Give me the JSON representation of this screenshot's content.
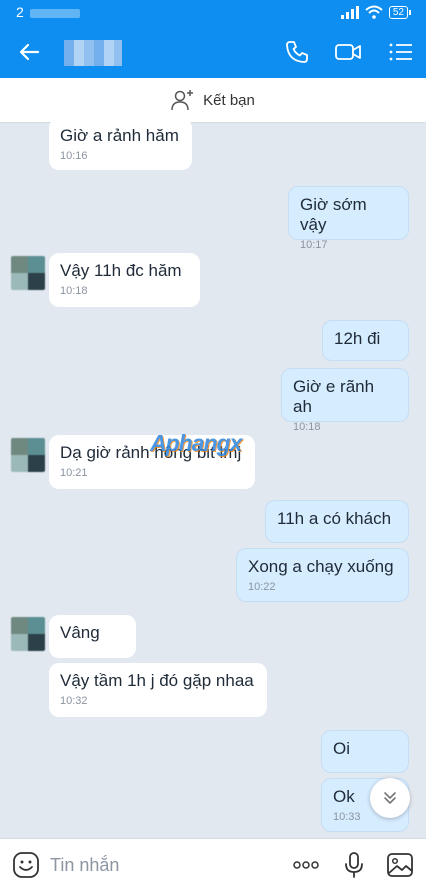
{
  "status_bar": {
    "time": "2",
    "battery": "52"
  },
  "header": {
    "back_label": "back"
  },
  "add_friend": {
    "label": "Kết bạn"
  },
  "messages": [
    {
      "dir": "in",
      "text": "Giờ a rảnh hăm",
      "time": "10:16"
    },
    {
      "dir": "out",
      "text": "Giờ sớm vậy",
      "time": "10:17"
    },
    {
      "dir": "in",
      "text": "Vậy 11h đc hăm",
      "time": "10:18"
    },
    {
      "dir": "out",
      "text": "12h đi",
      "time": ""
    },
    {
      "dir": "out",
      "text": "Giờ e rãnh ah",
      "time": "10:18"
    },
    {
      "dir": "in",
      "text": "Dạ giờ rảnh hông bit lmj",
      "time": "10:21"
    },
    {
      "dir": "out",
      "text": "11h a có khách",
      "time": ""
    },
    {
      "dir": "out",
      "text": "Xong a chạy xuống",
      "time": "10:22"
    },
    {
      "dir": "in",
      "text": "Vâng",
      "time": ""
    },
    {
      "dir": "in",
      "text": "Vậy tầm 1h j đó gặp nhaa",
      "time": "10:32"
    },
    {
      "dir": "out",
      "text": "Oi",
      "time": ""
    },
    {
      "dir": "out",
      "text": "Ok",
      "time": "10:33"
    }
  ],
  "watermark": "Aphangx",
  "composer": {
    "placeholder": "Tin nhắn"
  },
  "colors": {
    "header": "#0d8ef0",
    "outgoing_bubble": "#d6ecff",
    "incoming_bubble": "#ffffff",
    "background": "#e2e8ef"
  }
}
